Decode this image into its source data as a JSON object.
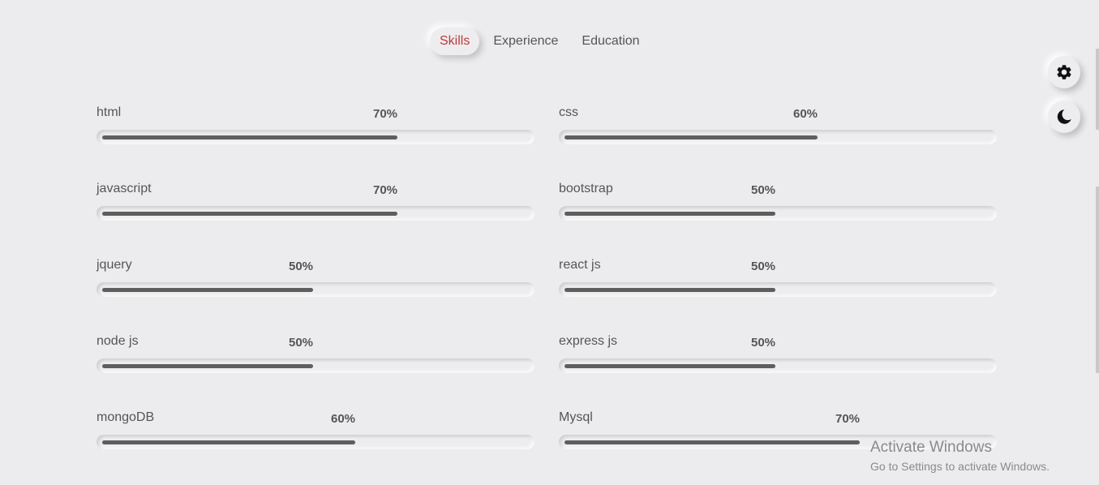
{
  "tabs": [
    {
      "label": "Skills",
      "active": true
    },
    {
      "label": "Experience",
      "active": false
    },
    {
      "label": "Education",
      "active": false
    }
  ],
  "skills": [
    {
      "name": "html",
      "percent_label": "70%",
      "value": 70
    },
    {
      "name": "css",
      "percent_label": "60%",
      "value": 60
    },
    {
      "name": "javascript",
      "percent_label": "70%",
      "value": 70
    },
    {
      "name": "bootstrap",
      "percent_label": "50%",
      "value": 50
    },
    {
      "name": "jquery",
      "percent_label": "50%",
      "value": 50
    },
    {
      "name": "react js",
      "percent_label": "50%",
      "value": 50
    },
    {
      "name": "node js",
      "percent_label": "50%",
      "value": 50
    },
    {
      "name": "express js",
      "percent_label": "50%",
      "value": 50
    },
    {
      "name": "mongoDB",
      "percent_label": "60%",
      "value": 60
    },
    {
      "name": "Mysql",
      "percent_label": "70%",
      "value": 70
    }
  ],
  "controls": {
    "settings_icon": "gear-icon",
    "theme_icon": "moon-icon"
  },
  "watermark": {
    "title": "Activate Windows",
    "subtitle": "Go to Settings to activate Windows."
  },
  "colors": {
    "active_tab": "#c0393b",
    "bar_fill": "#5e5e5e",
    "background": "#ececee"
  }
}
